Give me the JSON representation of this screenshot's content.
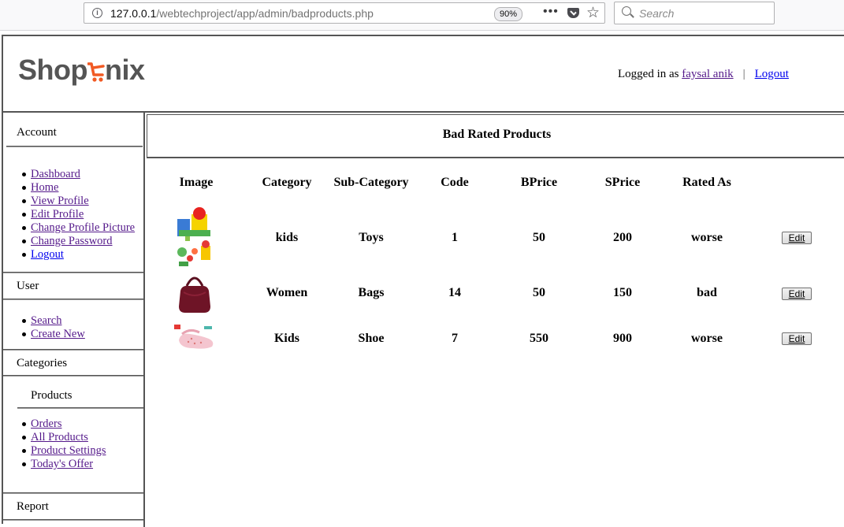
{
  "browser": {
    "url_prefix": "127.0.0.1",
    "url_path": "/webtechproject/app/admin/badproducts.php",
    "zoom": "90%",
    "search_placeholder": "Search",
    "menu_dots": "•••",
    "star": "☆"
  },
  "header": {
    "logo_left": "Shop",
    "logo_right": "nix",
    "logged_in_as": "Logged in as",
    "user_name": "faysal anik",
    "separator": "|",
    "logout": "Logout"
  },
  "sidebar": {
    "account_title": "Account",
    "account_items": [
      "Dashboard",
      "Home",
      "View Profile",
      "Edit Profile",
      "Change Profile Picture",
      "Change Password",
      "Logout"
    ],
    "user_title": "User",
    "user_items": [
      "Search",
      "Create New"
    ],
    "categories_title": "Categories",
    "products_title": "Products",
    "products_items": [
      "Orders",
      "All Products",
      "Product Settings",
      "Today's Offer"
    ],
    "report_title": "Report"
  },
  "main": {
    "title": "Bad Rated Products",
    "columns": [
      "Image",
      "Category",
      "Sub-Category",
      "Code",
      "BPrice",
      "SPrice",
      "Rated As"
    ],
    "rows": [
      {
        "image": "toys-image",
        "category": "kids",
        "subcategory": "Toys",
        "code": "1",
        "bprice": "50",
        "sprice": "200",
        "rated": "worse",
        "action": "Edit"
      },
      {
        "image": "bag-image",
        "category": "Women",
        "subcategory": "Bags",
        "code": "14",
        "bprice": "50",
        "sprice": "150",
        "rated": "bad",
        "action": "Edit"
      },
      {
        "image": "shoe-image",
        "category": "Kids",
        "subcategory": "Shoe",
        "code": "7",
        "bprice": "550",
        "sprice": "900",
        "rated": "worse",
        "action": "Edit"
      }
    ]
  },
  "colors": {
    "logo_gray": "#555555",
    "logo_orange": "#f15a24",
    "link_visited": "#551a8b",
    "link": "#0000ee"
  }
}
